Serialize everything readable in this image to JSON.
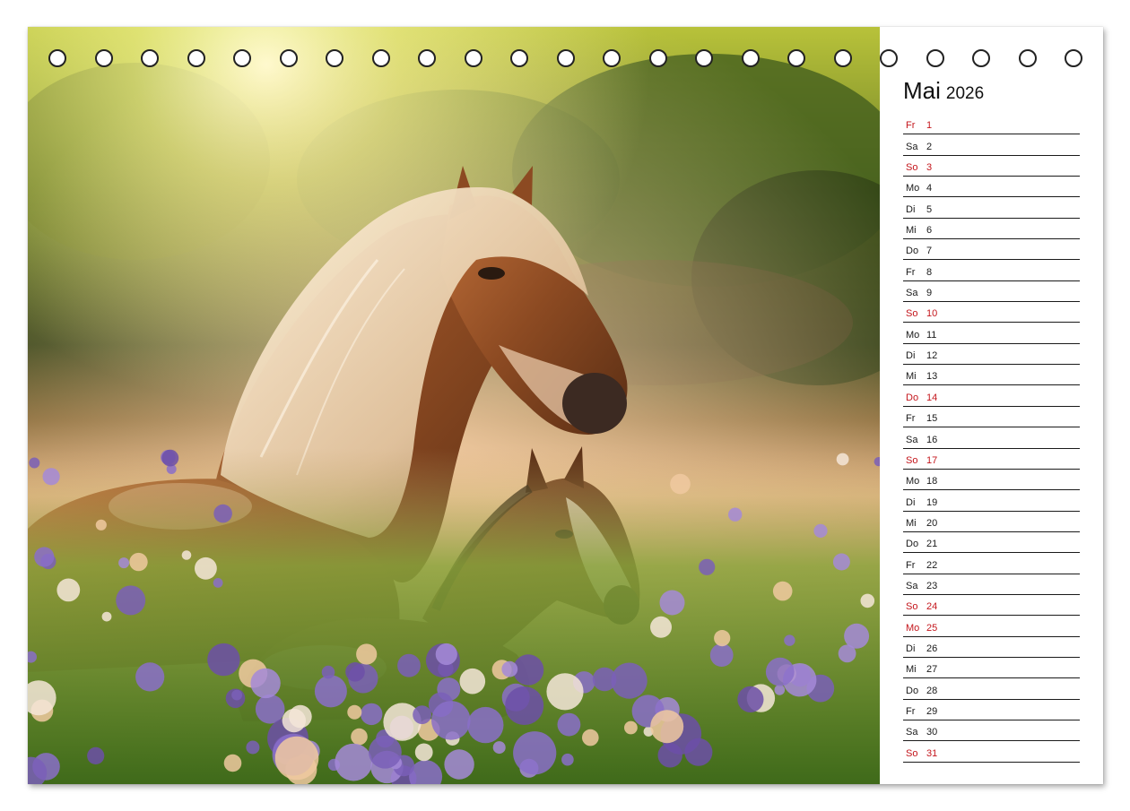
{
  "calendar": {
    "month": "Mai",
    "year": "2026",
    "days": [
      {
        "wd": "Fr",
        "n": "1",
        "red": true
      },
      {
        "wd": "Sa",
        "n": "2",
        "red": false
      },
      {
        "wd": "So",
        "n": "3",
        "red": true
      },
      {
        "wd": "Mo",
        "n": "4",
        "red": false
      },
      {
        "wd": "Di",
        "n": "5",
        "red": false
      },
      {
        "wd": "Mi",
        "n": "6",
        "red": false
      },
      {
        "wd": "Do",
        "n": "7",
        "red": false
      },
      {
        "wd": "Fr",
        "n": "8",
        "red": false
      },
      {
        "wd": "Sa",
        "n": "9",
        "red": false
      },
      {
        "wd": "So",
        "n": "10",
        "red": true
      },
      {
        "wd": "Mo",
        "n": "11",
        "red": false
      },
      {
        "wd": "Di",
        "n": "12",
        "red": false
      },
      {
        "wd": "Mi",
        "n": "13",
        "red": false
      },
      {
        "wd": "Do",
        "n": "14",
        "red": true
      },
      {
        "wd": "Fr",
        "n": "15",
        "red": false
      },
      {
        "wd": "Sa",
        "n": "16",
        "red": false
      },
      {
        "wd": "So",
        "n": "17",
        "red": true
      },
      {
        "wd": "Mo",
        "n": "18",
        "red": false
      },
      {
        "wd": "Di",
        "n": "19",
        "red": false
      },
      {
        "wd": "Mi",
        "n": "20",
        "red": false
      },
      {
        "wd": "Do",
        "n": "21",
        "red": false
      },
      {
        "wd": "Fr",
        "n": "22",
        "red": false
      },
      {
        "wd": "Sa",
        "n": "23",
        "red": false
      },
      {
        "wd": "So",
        "n": "24",
        "red": true
      },
      {
        "wd": "Mo",
        "n": "25",
        "red": true
      },
      {
        "wd": "Di",
        "n": "26",
        "red": false
      },
      {
        "wd": "Mi",
        "n": "27",
        "red": false
      },
      {
        "wd": "Do",
        "n": "28",
        "red": false
      },
      {
        "wd": "Fr",
        "n": "29",
        "red": false
      },
      {
        "wd": "Sa",
        "n": "30",
        "red": false
      },
      {
        "wd": "So",
        "n": "31",
        "red": true
      }
    ]
  },
  "colors": {
    "holiday_red": "#c4161c",
    "text": "#1a1a1a"
  },
  "binding_holes": 23
}
